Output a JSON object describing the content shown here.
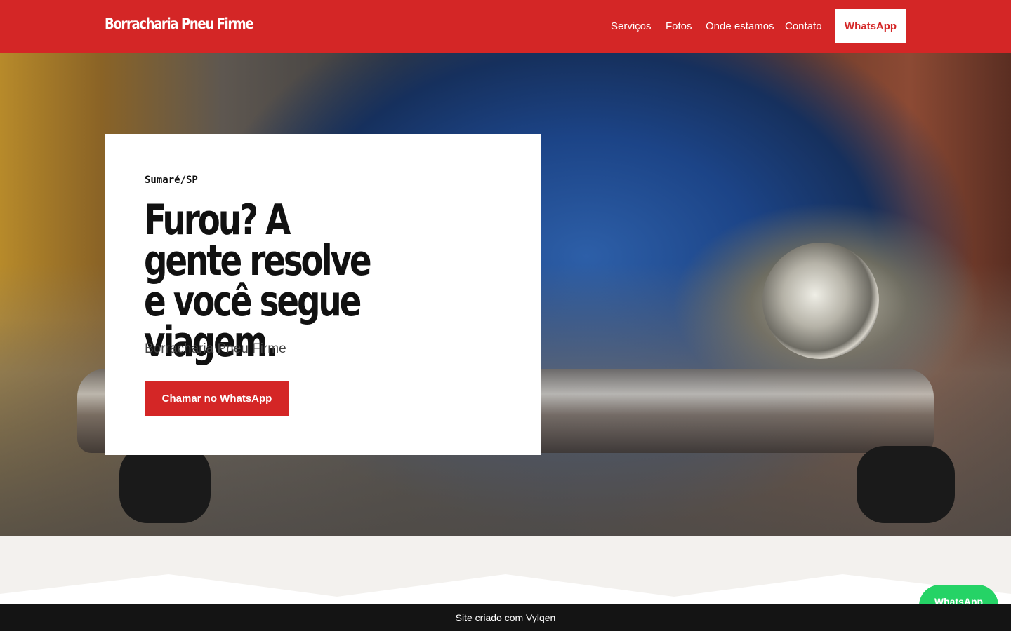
{
  "header": {
    "logo": "Borracharia Pneu Firme",
    "nav": [
      "Serviços",
      "Fotos",
      "Onde estamos",
      "Contato"
    ],
    "whatsapp_label": "WhatsApp"
  },
  "hero": {
    "location": "Sumaré/SP",
    "headline": "Furou? A gente resolve e você segue viagem.",
    "subtitle": "Borracharia Pneu Firme",
    "cta_label": "Chamar no WhatsApp"
  },
  "floating_whatsapp": "WhatsApp",
  "footer": {
    "text": "Site criado com Vylqen"
  },
  "colors": {
    "brand_red": "#d42626",
    "whatsapp_green": "#25d366",
    "footer_bg": "#141414"
  }
}
